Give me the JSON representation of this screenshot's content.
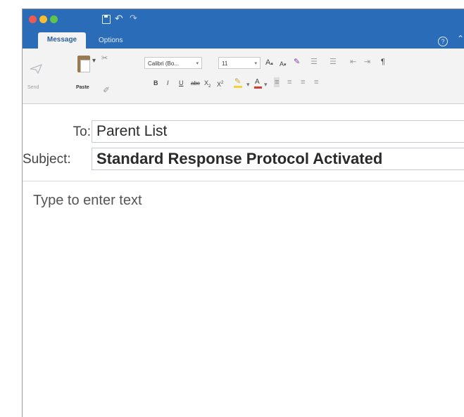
{
  "quick_access": {
    "save_icon": "save-icon",
    "undo_icon": "undo-icon",
    "redo_icon": "redo-icon"
  },
  "tabs": [
    {
      "label": "Message",
      "selected": true
    },
    {
      "label": "Options",
      "selected": false
    }
  ],
  "ribbon": {
    "send_label": "Send",
    "paste_label": "Paste",
    "font_name": "Calibri (Bo...",
    "font_size": "11",
    "grow_font": "A",
    "shrink_font": "A",
    "bold": "B",
    "italic": "I",
    "underline": "U",
    "strikethrough": "abc",
    "subscript": "X",
    "superscript": "X",
    "font_color": "A",
    "paragraph_mark": "¶"
  },
  "header": {
    "to_label": "To:",
    "to_value": "Parent List",
    "subject_label": "Subject:",
    "subject_value": "Standard Response Protocol Activated"
  },
  "body": {
    "placeholder": "Type to enter text"
  },
  "colors": {
    "titlebar": "#2b6cb8",
    "ribbon_bg": "#f3f3f3",
    "highlight": "#f2d33a",
    "font_color_bar": "#d63b2f"
  }
}
